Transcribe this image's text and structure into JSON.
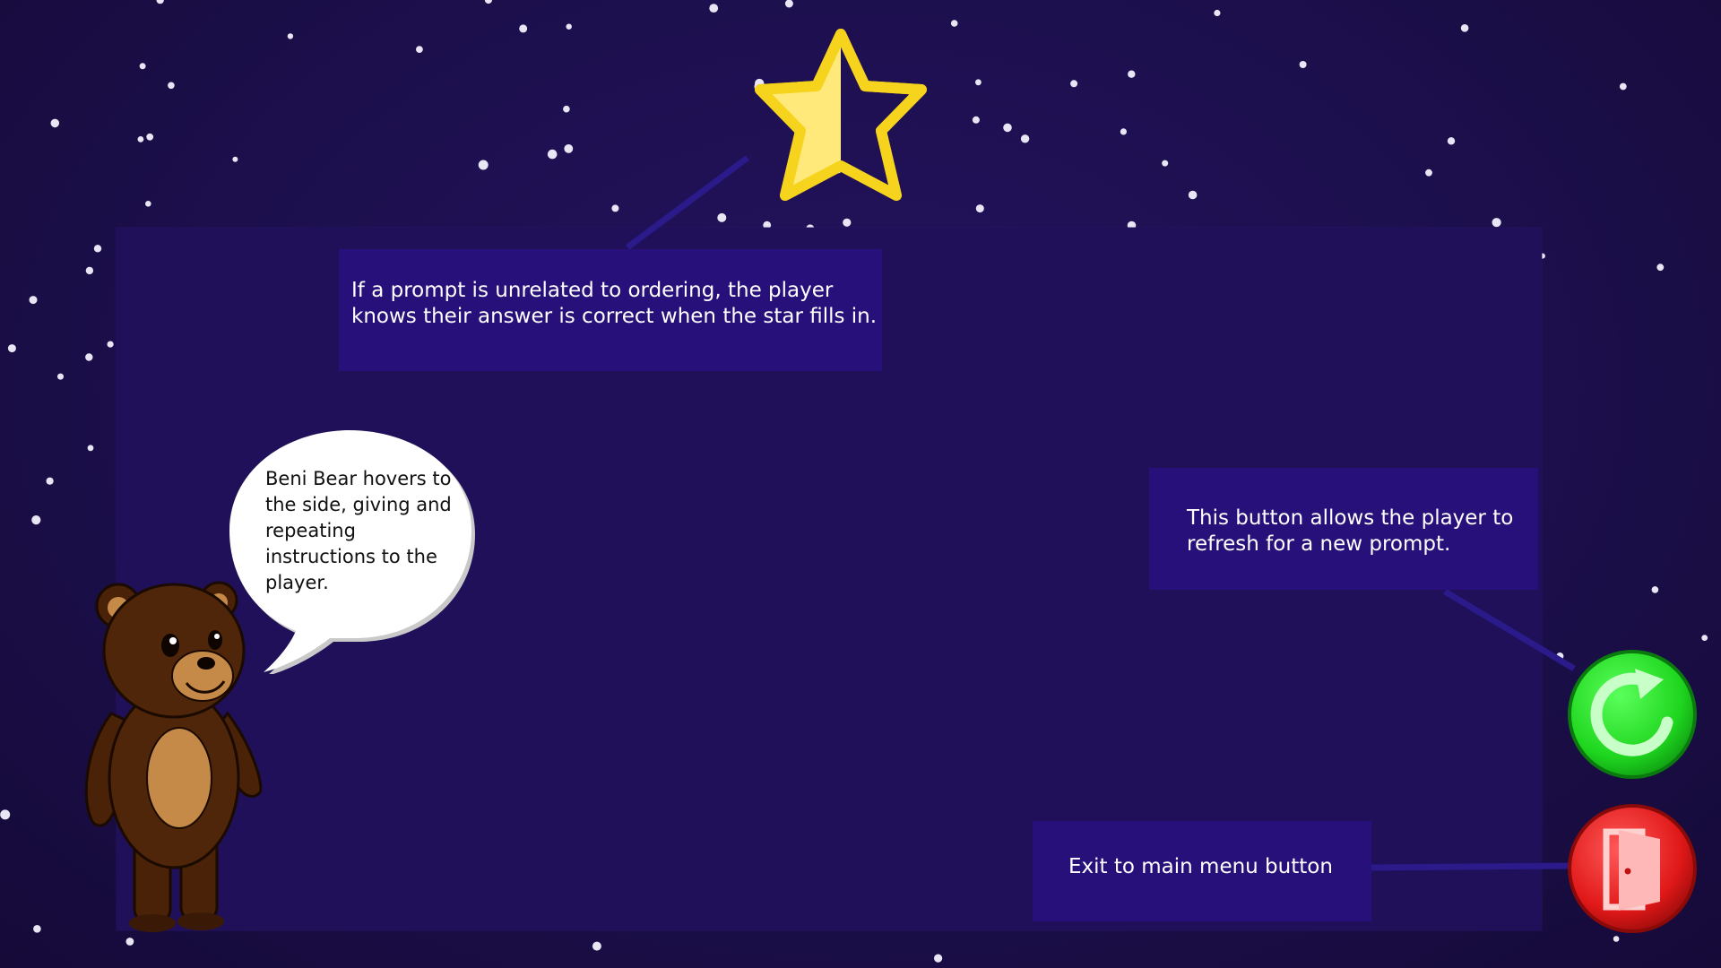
{
  "callouts": {
    "star": "If a prompt is unrelated to ordering, the player knows their answer is correct when the star fills in.",
    "refresh": "This button allows the player to refresh for a new prompt.",
    "exit": "Exit to main menu button"
  },
  "bear": {
    "speech": "Beni Bear hovers to the side, giving and repeating instructions to the player."
  },
  "progress_star": {
    "fill_fraction": 0.5,
    "fill_color": "#ffe97a",
    "outline_color": "#f6d31c"
  },
  "buttons": {
    "refresh": {
      "icon": "refresh-icon",
      "color": "#1fd61f"
    },
    "exit": {
      "icon": "exit-door-icon",
      "color": "#e01818"
    }
  },
  "colors": {
    "background": "#1c0f4c",
    "panel": "#1f1059",
    "callout": "#27107a"
  }
}
